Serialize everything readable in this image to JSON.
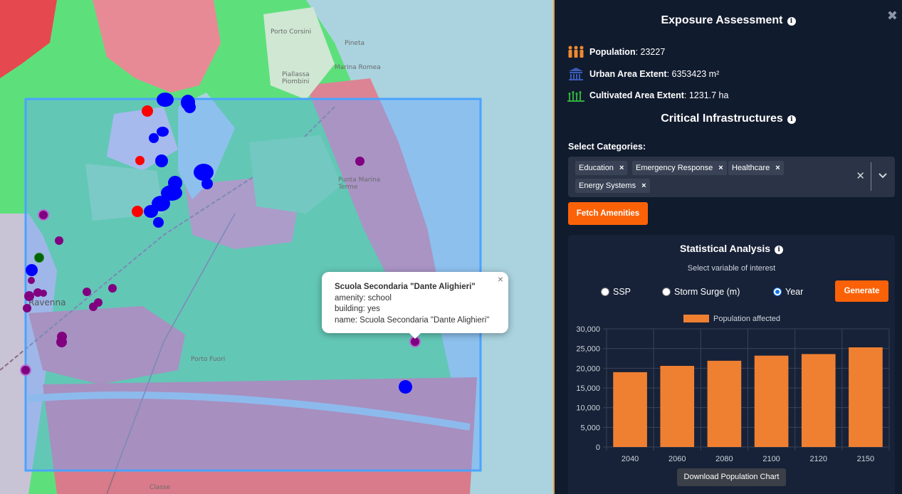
{
  "map": {
    "labels": {
      "ravenna": "Ravenna",
      "porto_corsini": "Porto Corsini",
      "marina_romea": "Marina Romea",
      "punta_marina": "Punta Marina Terme",
      "porto_fuori": "Porto Fuori",
      "piombini": "Piallassa Piombini",
      "classe": "Classe",
      "pineta": "Pineta"
    },
    "popup": {
      "title": "Scuola Secondaria \"Dante Alighieri\"",
      "line1": "amenity: school",
      "line2": "building: yes",
      "line3": "name: Scuola Secondaria \"Dante Alighieri\"",
      "close": "×"
    },
    "colors": {
      "education": "#0000ff",
      "emergency": "#ff0000",
      "healthcare": "#800080",
      "energy": "#006400",
      "bbox": "#4aa3ff"
    }
  },
  "panel": {
    "close": "✖",
    "exposure": {
      "title": "Exposure Assessment",
      "population_label": "Population",
      "population_value": ": 23227",
      "urban_label": "Urban Area Extent",
      "urban_value": ": 6353423 m²",
      "cultivated_label": "Cultivated Area Extent",
      "cultivated_value": ": 1231.7 ha"
    },
    "critical": {
      "title": "Critical Infrastructures",
      "select_label": "Select Categories:",
      "chips": [
        "Education",
        "Emergency Response",
        "Healthcare",
        "Energy Systems"
      ],
      "chip_remove": "×",
      "clear": "✕",
      "fetch_button": "Fetch Amenities"
    },
    "stats": {
      "title": "Statistical Analysis",
      "subtitle": "Select variable of interest",
      "options": [
        "SSP",
        "Storm Surge (m)",
        "Year"
      ],
      "selected": "Year",
      "generate_button": "Generate",
      "download_button": "Download Population Chart"
    }
  },
  "chart_data": {
    "type": "bar",
    "categories": [
      "2040",
      "2060",
      "2080",
      "2100",
      "2120",
      "2150"
    ],
    "series": [
      {
        "name": "Population affected",
        "values": [
          19000,
          20600,
          21900,
          23200,
          23600,
          25300
        ],
        "color": "#f08031"
      }
    ],
    "ylim": [
      0,
      30000
    ],
    "yticks": [
      "30,000",
      "25,000",
      "20,000",
      "15,000",
      "10,000",
      "5,000",
      "0"
    ],
    "ytick_values": [
      30000,
      25000,
      20000,
      15000,
      10000,
      5000,
      0
    ],
    "legend": "top",
    "grid": true
  }
}
